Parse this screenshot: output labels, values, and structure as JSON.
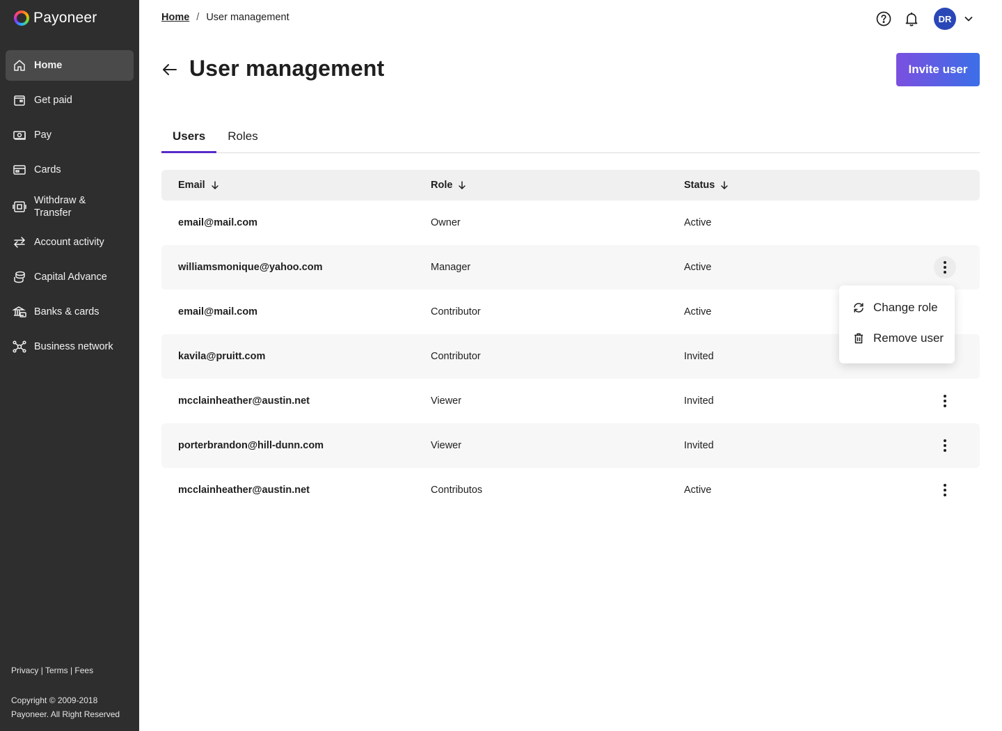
{
  "brand": {
    "name": "Payoneer"
  },
  "sidebar": {
    "items": [
      {
        "label": "Home",
        "icon": "home-icon"
      },
      {
        "label": "Get paid",
        "icon": "wallet-icon"
      },
      {
        "label": "Pay",
        "icon": "cash-icon"
      },
      {
        "label": "Cards",
        "icon": "card-icon"
      },
      {
        "label": "Withdraw & Transfer",
        "icon": "withdraw-icon"
      },
      {
        "label": "Account activity",
        "icon": "transfer-arrows-icon"
      },
      {
        "label": "Capital Advance",
        "icon": "coins-icon"
      },
      {
        "label": "Banks & cards",
        "icon": "bank-icon"
      },
      {
        "label": "Business network",
        "icon": "network-icon"
      }
    ],
    "footer": {
      "privacy": "Privacy",
      "terms": "Terms",
      "fees": "Fees",
      "separator": "|"
    },
    "copyright": "Copyright © 2009-2018 Payoneer. All Right Reserved"
  },
  "header": {
    "breadcrumb": {
      "home": "Home",
      "separator": "/",
      "current": "User management"
    },
    "avatar_initials": "DR"
  },
  "page": {
    "title": "User management",
    "invite_button": "Invite user"
  },
  "tabs": [
    {
      "label": "Users",
      "active": true
    },
    {
      "label": "Roles",
      "active": false
    }
  ],
  "table": {
    "columns": {
      "email": "Email",
      "role": "Role",
      "status": "Status"
    },
    "rows": [
      {
        "email": "email@mail.com",
        "role": "Owner",
        "status": "Active"
      },
      {
        "email": "williamsmonique@yahoo.com",
        "role": "Manager",
        "status": "Active"
      },
      {
        "email": "email@mail.com",
        "role": "Contributor",
        "status": "Active"
      },
      {
        "email": "kavila@pruitt.com",
        "role": "Contributor",
        "status": "Invited"
      },
      {
        "email": "mcclainheather@austin.net",
        "role": "Viewer",
        "status": "Invited"
      },
      {
        "email": "porterbrandon@hill-dunn.com",
        "role": "Viewer",
        "status": "Invited"
      },
      {
        "email": "mcclainheather@austin.net",
        "role": "Contributos",
        "status": "Active"
      }
    ]
  },
  "row_menu": {
    "change_role": "Change role",
    "remove_user": "Remove user"
  },
  "colors": {
    "sidebar_bg": "#2e2e2e",
    "active_tab": "#5a2bc9",
    "invite_gradient_start": "#7b4fe0",
    "invite_gradient_end": "#3b6fe8",
    "avatar_bg": "#2a47b8"
  }
}
